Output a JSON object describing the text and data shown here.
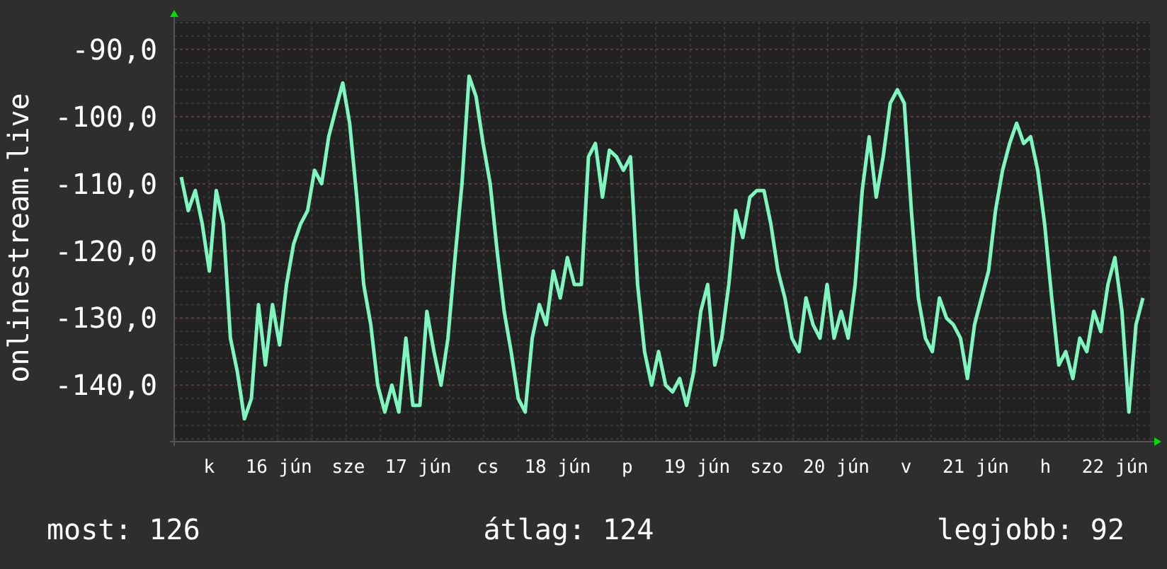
{
  "chart": {
    "day_labels": [
      "k",
      "16 jún",
      "sze",
      "17 jún",
      "cs",
      "18 jún",
      "p",
      "19 jún",
      "szo",
      "20 jún",
      "v",
      "21 jún",
      "h",
      "22 jún"
    ],
    "chart_data": {
      "type": "line",
      "grid": true,
      "ylim": [
        -148.4,
        -85.8
      ],
      "yticks": [
        {
          "value": -90,
          "label": "-90,0"
        },
        {
          "value": -100,
          "label": "-100,0"
        },
        {
          "value": -110,
          "label": "-110,0"
        },
        {
          "value": -120,
          "label": "-120,0"
        },
        {
          "value": -130,
          "label": "-130,0"
        },
        {
          "value": -140,
          "label": "-140,0"
        }
      ],
      "series": [
        {
          "name": "onlinestream.live",
          "color": "#7ff5c0",
          "values": [
            -109,
            -114,
            -111,
            -116,
            -123,
            -111,
            -116,
            -133,
            -138,
            -145,
            -142,
            -128,
            -137,
            -128,
            -134,
            -125,
            -119,
            -116,
            -114,
            -108,
            -110,
            -103,
            -99,
            -95,
            -101,
            -112,
            -125,
            -131,
            -140,
            -144,
            -140,
            -144,
            -133,
            -143,
            -143,
            -129,
            -135,
            -140,
            -133,
            -121,
            -110,
            -94,
            -97,
            -104,
            -110,
            -120,
            -129,
            -135,
            -142,
            -144,
            -133,
            -128,
            -131,
            -123,
            -127,
            -121,
            -125,
            -125,
            -106,
            -104,
            -112,
            -105,
            -106,
            -108,
            -106,
            -125,
            -135,
            -140,
            -135,
            -140,
            -141,
            -139,
            -143,
            -138,
            -129,
            -125,
            -137,
            -133,
            -125,
            -114,
            -118,
            -112,
            -111,
            -111,
            -116,
            -123,
            -127,
            -133,
            -135,
            -127,
            -131,
            -133,
            -125,
            -133,
            -129,
            -133,
            -125,
            -111,
            -103,
            -112,
            -106,
            -98,
            -96,
            -98,
            -114,
            -127,
            -133,
            -135,
            -127,
            -130,
            -131,
            -133,
            -139,
            -131,
            -127,
            -123,
            -114,
            -108,
            -104,
            -101,
            -104,
            -103,
            -108,
            -116,
            -127,
            -137,
            -135,
            -139,
            -133,
            -135,
            -129,
            -132,
            -125,
            -121,
            -129,
            -144,
            -131,
            -127
          ]
        }
      ]
    }
  },
  "footer": {
    "current": "most: 126",
    "average": "átlag: 124",
    "best": "legjobb: 92"
  }
}
